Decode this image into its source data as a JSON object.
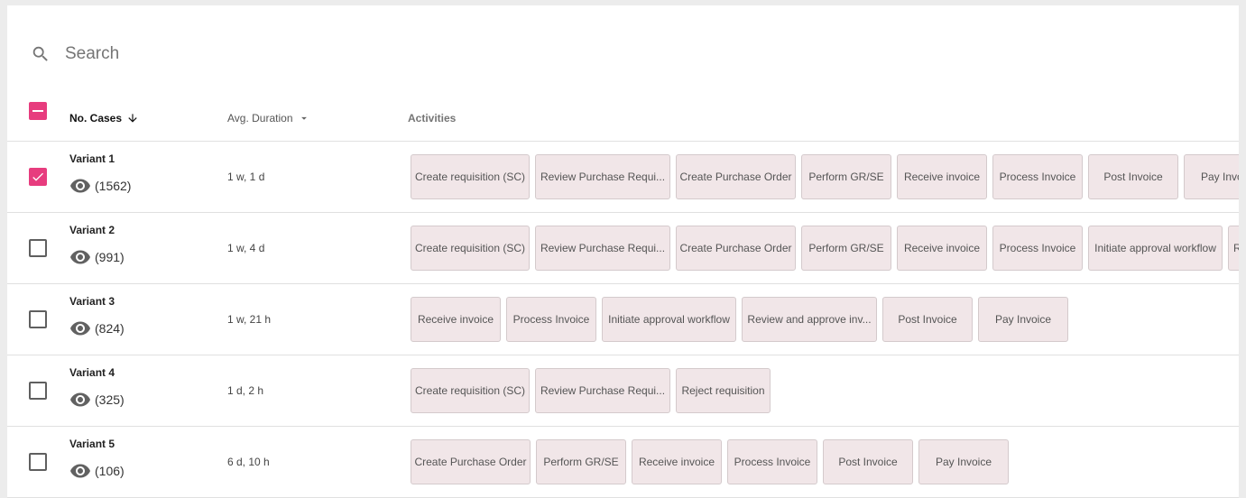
{
  "search": {
    "placeholder": "Search"
  },
  "columns": {
    "cases": "No. Cases",
    "duration": "Avg. Duration",
    "activities": "Activities"
  },
  "colors": {
    "accent": "#e73c7e",
    "chip_bg": "#f1e6e8"
  },
  "rows": [
    {
      "name": "Variant 1",
      "cases": "(1562)",
      "duration": "1 w, 1 d",
      "checked": true,
      "activities": [
        "Create requisition (SC)",
        "Review Purchase Requi...",
        "Create Purchase Order",
        "Perform GR/SE",
        "Receive invoice",
        "Process Invoice",
        "Post Invoice",
        "Pay Invoice"
      ]
    },
    {
      "name": "Variant 2",
      "cases": "(991)",
      "duration": "1 w, 4 d",
      "checked": false,
      "activities": [
        "Create requisition (SC)",
        "Review Purchase Requi...",
        "Create Purchase Order",
        "Perform GR/SE",
        "Receive invoice",
        "Process Invoice",
        "Initiate approval workflow",
        "Review and approve inv..."
      ]
    },
    {
      "name": "Variant 3",
      "cases": "(824)",
      "duration": "1 w, 21 h",
      "checked": false,
      "activities": [
        "Receive invoice",
        "Process Invoice",
        "Initiate approval workflow",
        "Review and approve inv...",
        "Post Invoice",
        "Pay Invoice"
      ]
    },
    {
      "name": "Variant 4",
      "cases": "(325)",
      "duration": "1 d, 2 h",
      "checked": false,
      "activities": [
        "Create requisition (SC)",
        "Review Purchase Requi...",
        "Reject requisition"
      ]
    },
    {
      "name": "Variant 5",
      "cases": "(106)",
      "duration": "6 d, 10 h",
      "checked": false,
      "activities": [
        "Create Purchase Order",
        "Perform GR/SE",
        "Receive invoice",
        "Process Invoice",
        "Post Invoice",
        "Pay Invoice"
      ]
    }
  ]
}
